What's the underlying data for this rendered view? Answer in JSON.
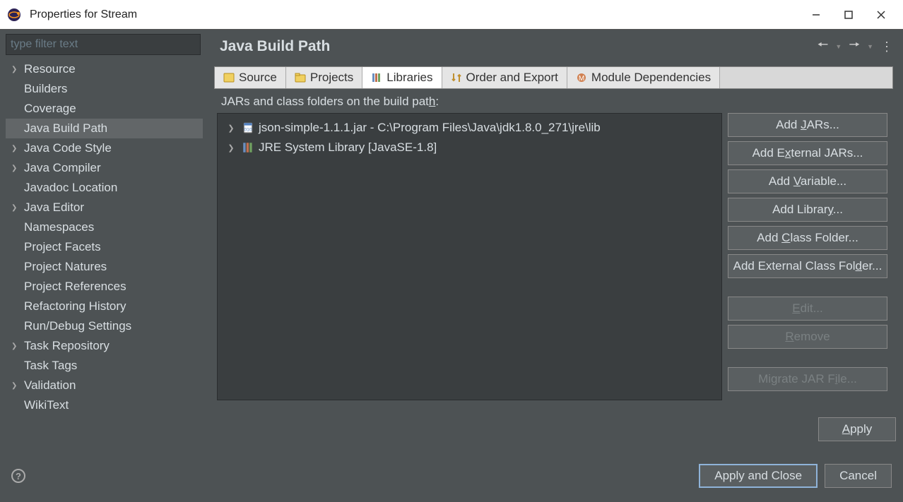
{
  "window": {
    "title": "Properties for Stream"
  },
  "sidebar": {
    "filter_placeholder": "type filter text",
    "items": [
      {
        "label": "Resource",
        "expandable": true
      },
      {
        "label": "Builders",
        "expandable": false
      },
      {
        "label": "Coverage",
        "expandable": false
      },
      {
        "label": "Java Build Path",
        "expandable": false,
        "selected": true
      },
      {
        "label": "Java Code Style",
        "expandable": true
      },
      {
        "label": "Java Compiler",
        "expandable": true
      },
      {
        "label": "Javadoc Location",
        "expandable": false
      },
      {
        "label": "Java Editor",
        "expandable": true
      },
      {
        "label": "Namespaces",
        "expandable": false
      },
      {
        "label": "Project Facets",
        "expandable": false
      },
      {
        "label": "Project Natures",
        "expandable": false
      },
      {
        "label": "Project References",
        "expandable": false
      },
      {
        "label": "Refactoring History",
        "expandable": false
      },
      {
        "label": "Run/Debug Settings",
        "expandable": false
      },
      {
        "label": "Task Repository",
        "expandable": true
      },
      {
        "label": "Task Tags",
        "expandable": false
      },
      {
        "label": "Validation",
        "expandable": true
      },
      {
        "label": "WikiText",
        "expandable": false
      }
    ]
  },
  "header": {
    "title": "Java Build Path"
  },
  "tabs": [
    {
      "label": "Source"
    },
    {
      "label": "Projects"
    },
    {
      "label": "Libraries",
      "active": true
    },
    {
      "label": "Order and Export"
    },
    {
      "label": "Module Dependencies"
    }
  ],
  "libraries": {
    "caption_pre": "JARs and class folders on the build pat",
    "caption_u": "h",
    "caption_post": ":",
    "items": [
      {
        "label": "json-simple-1.1.1.jar - C:\\Program Files\\Java\\jdk1.8.0_271\\jre\\lib",
        "icon": "jar"
      },
      {
        "label": "JRE System Library [JavaSE-1.8]",
        "icon": "lib"
      }
    ]
  },
  "buttons": {
    "add_jars_pre": "Add ",
    "add_jars_u": "J",
    "add_jars_post": "ARs...",
    "add_ext_jars_pre": "Add E",
    "add_ext_jars_u": "x",
    "add_ext_jars_post": "ternal JARs...",
    "add_var_pre": "Add ",
    "add_var_u": "V",
    "add_var_post": "ariable...",
    "add_lib_pre": "Add Librar",
    "add_lib_u": "y",
    "add_lib_post": "...",
    "add_cf_pre": "Add ",
    "add_cf_u": "C",
    "add_cf_post": "lass Folder...",
    "add_ecf_pre": "Add External Class Fol",
    "add_ecf_u": "d",
    "add_ecf_post": "er...",
    "edit_u": "E",
    "edit_post": "dit...",
    "remove_u": "R",
    "remove_post": "emove",
    "migrate_pre": "Migrate JAR F",
    "migrate_u": "i",
    "migrate_post": "le...",
    "apply_u": "A",
    "apply_post": "pply"
  },
  "footer": {
    "apply_close": "Apply and Close",
    "cancel": "Cancel"
  }
}
